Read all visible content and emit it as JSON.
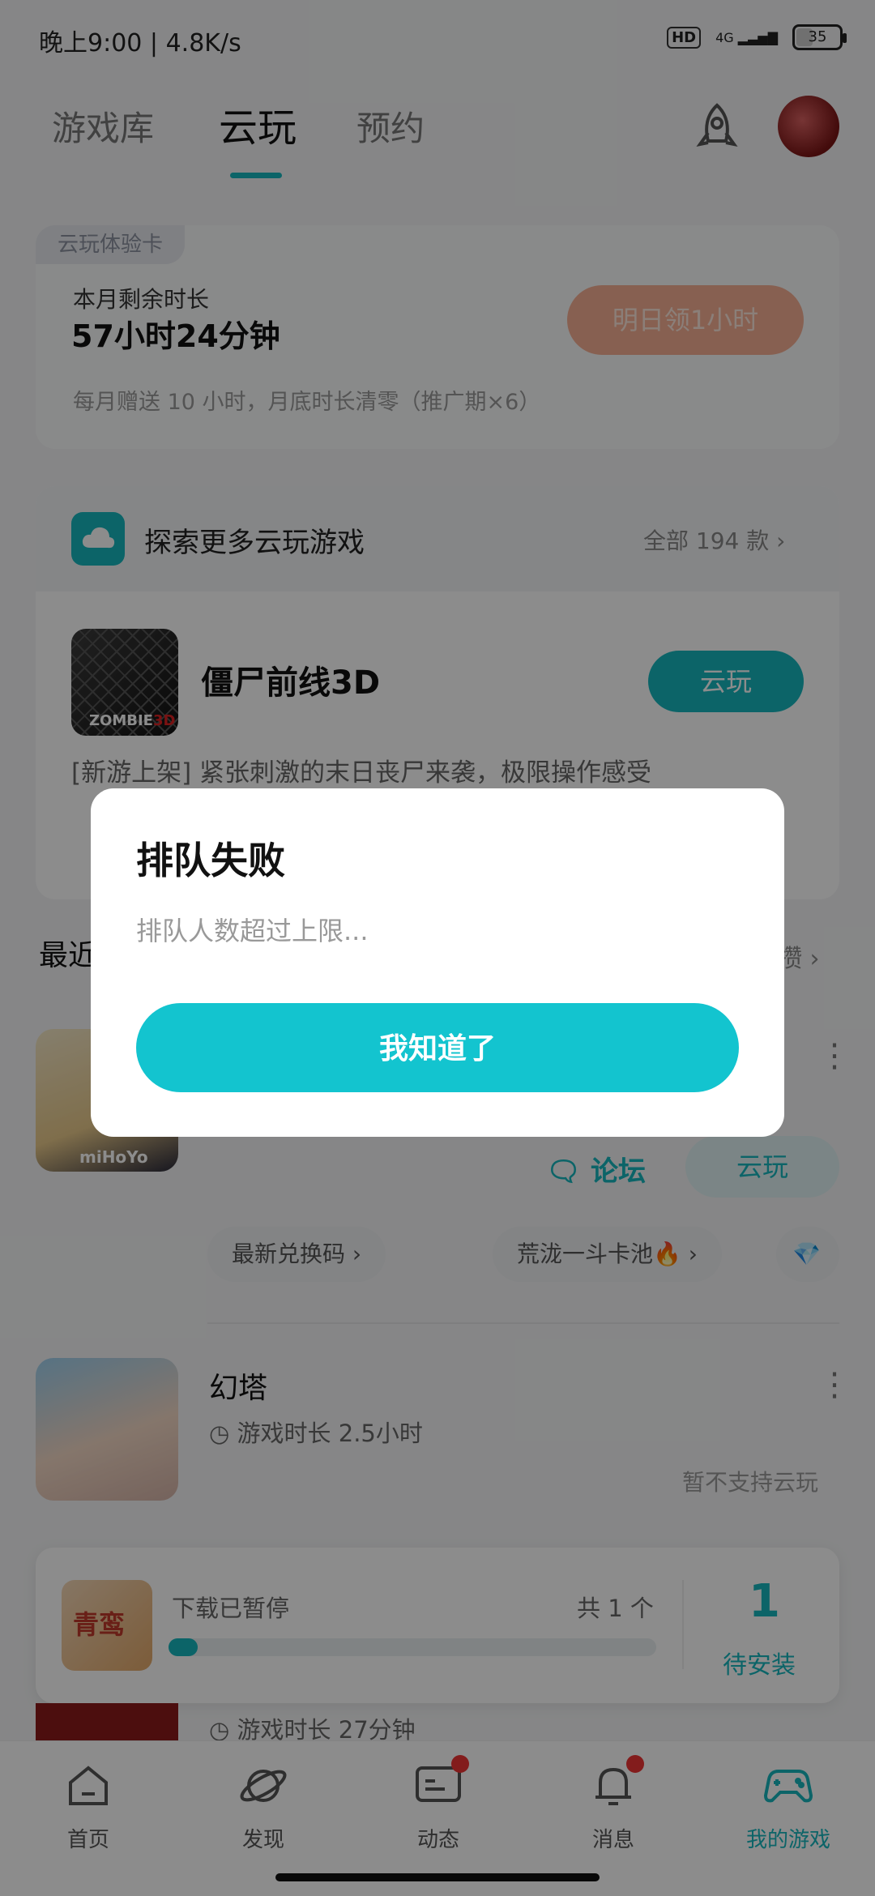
{
  "status_bar": {
    "time": "晚上9:00",
    "speed": "4.8K/s",
    "hd": "HD",
    "net": "4G",
    "battery": "35"
  },
  "top_tabs": [
    {
      "label": "游戏库"
    },
    {
      "label": "云玩"
    },
    {
      "label": "预约"
    }
  ],
  "cloud_card": {
    "badge": "云玩体验卡",
    "remain_label": "本月剩余时长",
    "remain_value": "57小时24分钟",
    "claim_button": "明日领1小时",
    "note": "每月赠送 10 小时，月底时长清零（推广期×6）"
  },
  "explore": {
    "title": "探索更多云玩游戏",
    "all": "全部 194 款",
    "game_name": "僵尸前线3D",
    "game_logo": "ZOMBIE",
    "game_logo_sub": "3D",
    "button": "云玩",
    "desc": "[新游上架] 紧张刺激的末日丧尸来袭，极限操作感受"
  },
  "recent": {
    "title": "最近",
    "right": "攒",
    "genshin_brand": "miHoYo",
    "forum": "论坛",
    "cloud_button": "云玩",
    "chips": [
      "最新兑换码",
      "荒泷一斗卡池🔥"
    ],
    "tower": {
      "name": "幻塔",
      "time": "游戏时长 2.5小时",
      "no_cloud": "暂不支持云玩"
    }
  },
  "download": {
    "game_title": "青鸾",
    "status": "下载已暂停",
    "count": "共 1 个",
    "progress": 0.06,
    "pending_num": "1",
    "pending_label": "待安装",
    "partial_time": "游戏时长 27分钟"
  },
  "nav": [
    {
      "label": "首页"
    },
    {
      "label": "发现"
    },
    {
      "label": "动态"
    },
    {
      "label": "消息"
    },
    {
      "label": "我的游戏"
    }
  ],
  "dialog": {
    "title": "排队失败",
    "message": "排队人数超过上限...",
    "button": "我知道了"
  },
  "colors": {
    "accent": "#16b6bd",
    "claim": "#f6b094",
    "badge_red": "#e33333"
  }
}
